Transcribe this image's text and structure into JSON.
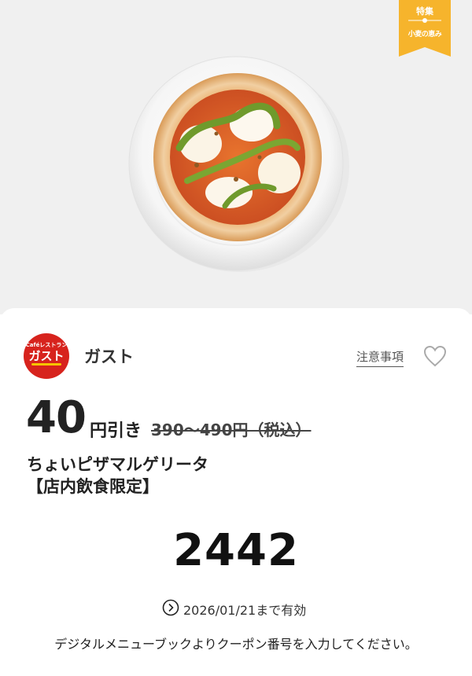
{
  "ribbon": {
    "top_label": "特集",
    "bottom_label": "小麦の恵み",
    "color": "#f6b42c"
  },
  "hero": {
    "image_name": "margherita-pizza-photo"
  },
  "brand": {
    "logo_small": "Caféレストラン",
    "logo_main": "ガスト",
    "name": "ガスト",
    "logo_color": "#d7231d"
  },
  "notes_link": "注意事項",
  "coupon": {
    "discount_value": "40",
    "discount_unit": "円引き",
    "original_price": "390〜490円（税込）",
    "item_name": "ちょいピザマルゲリータ",
    "item_note": "【店内飲食限定】",
    "code": "2442",
    "expiry": "2026/01/21まで有効",
    "instruction": "デジタルメニューブックよりクーポン番号を入力してください。"
  }
}
